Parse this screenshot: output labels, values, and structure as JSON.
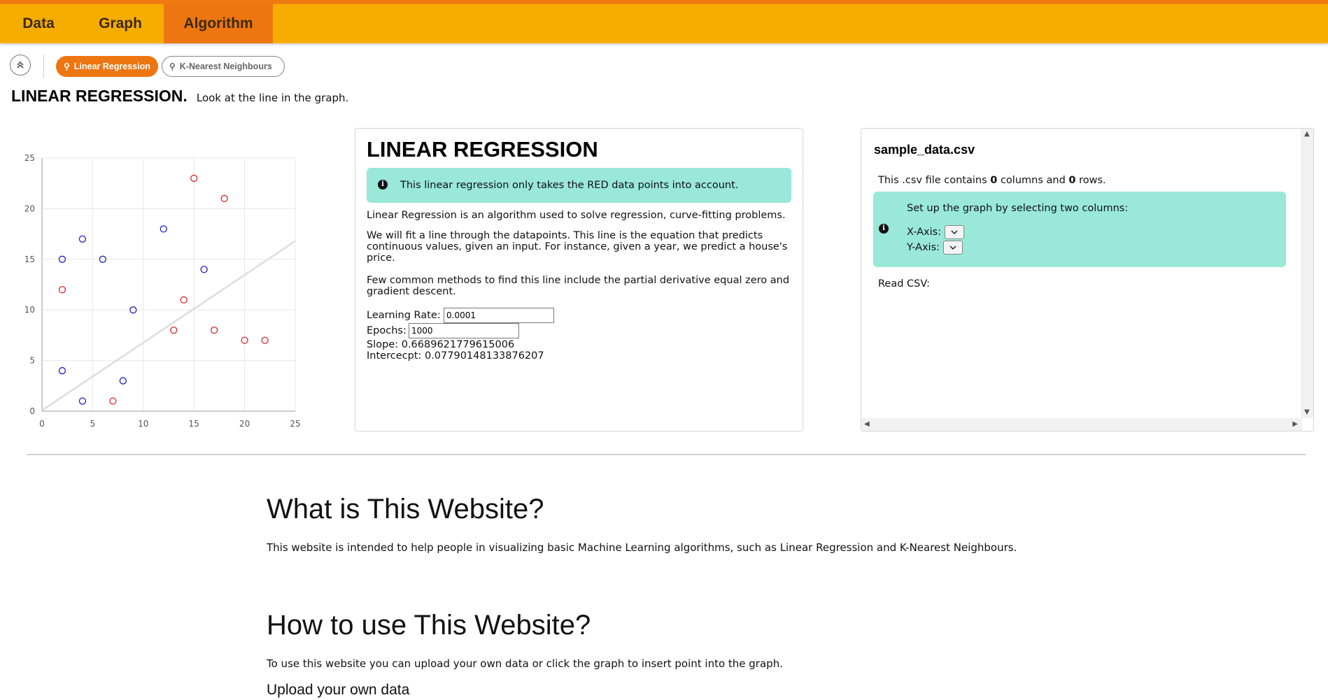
{
  "nav": {
    "tabs": [
      {
        "label": "Data"
      },
      {
        "label": "Graph"
      },
      {
        "label": "Algorithm"
      }
    ],
    "active_tab": "Algorithm"
  },
  "algo_tabs": [
    {
      "label": "Linear Regression",
      "active": true
    },
    {
      "label": "K-Nearest Neighbours",
      "active": false
    }
  ],
  "heading": {
    "title": "LINEAR REGRESSION.",
    "subtitle": "Look at the line in the graph."
  },
  "chart_data": {
    "type": "scatter",
    "title": "",
    "xlabel": "",
    "ylabel": "",
    "xlim": [
      0,
      25
    ],
    "ylim": [
      0,
      25
    ],
    "x_ticks": [
      "0",
      "5",
      "10",
      "15",
      "20",
      "25"
    ],
    "y_ticks": [
      "0",
      "5",
      "10",
      "15",
      "20",
      "25"
    ],
    "grid": true,
    "series": [
      {
        "color": "#d62728",
        "points": [
          [
            2,
            12
          ],
          [
            7,
            1
          ],
          [
            13,
            8
          ],
          [
            14,
            11
          ],
          [
            15,
            23
          ],
          [
            17,
            8
          ],
          [
            18,
            21
          ],
          [
            20,
            7
          ],
          [
            22,
            7
          ]
        ]
      },
      {
        "color": "#1f1fcc",
        "points": [
          [
            2,
            15
          ],
          [
            2,
            4
          ],
          [
            4,
            17
          ],
          [
            4,
            1
          ],
          [
            6,
            15
          ],
          [
            8,
            3
          ],
          [
            9,
            10
          ],
          [
            12,
            18
          ],
          [
            16,
            14
          ]
        ]
      }
    ],
    "regression_line": {
      "slope": 0.6689621779615006,
      "intercept": 0.07790148133876207,
      "color": "#dddddd"
    }
  },
  "lr_panel": {
    "title": "LINEAR REGRESSION",
    "info": "This linear regression only takes the RED data points into account.",
    "p1": "Linear Regression is an algorithm used to solve regression, curve-fitting problems.",
    "p2": "We will fit a line through the datapoints. This line is the equation that predicts continuous values, given an input. For instance, given a year, we predict a house's price.",
    "p3": "Few common methods to find this line include the partial derivative equal zero and gradient descent.",
    "learning_rate_label": "Learning Rate:",
    "learning_rate_value": "0.0001",
    "epochs_label": "Epochs:",
    "epochs_value": "1000",
    "slope_text": "Slope: 0.6689621779615006",
    "intercept_text": "Intercecpt: 0.07790148133876207"
  },
  "csv_panel": {
    "title": "sample_data.csv",
    "desc_prefix": "This .csv file contains ",
    "columns": "0",
    "desc_mid": " columns and ",
    "rows": "0",
    "desc_suffix": " rows.",
    "setup_text": "Set up the graph by selecting two columns:",
    "x_axis_label": "X-Axis:",
    "y_axis_label": "Y-Axis:",
    "read_csv_label": "Read CSV:"
  },
  "about": {
    "what_title": "What is This Website?",
    "what_text": "This website is intended to help people in visualizing basic Machine Learning algorithms, such as Linear Regression and K-Nearest Neighbours.",
    "how_title": "How to use This Website?",
    "how_text": "To use this website you can upload your own data or click the graph to insert point into the graph.",
    "upload_title": "Upload your own data"
  },
  "colors": {
    "nav_bg": "#f7ad00",
    "nav_active": "#ee7611",
    "info_bg": "#99e8da"
  },
  "icons": [
    "chevron-up-double-icon",
    "lightbulb-icon",
    "info-icon",
    "chevron-down-icon"
  ]
}
